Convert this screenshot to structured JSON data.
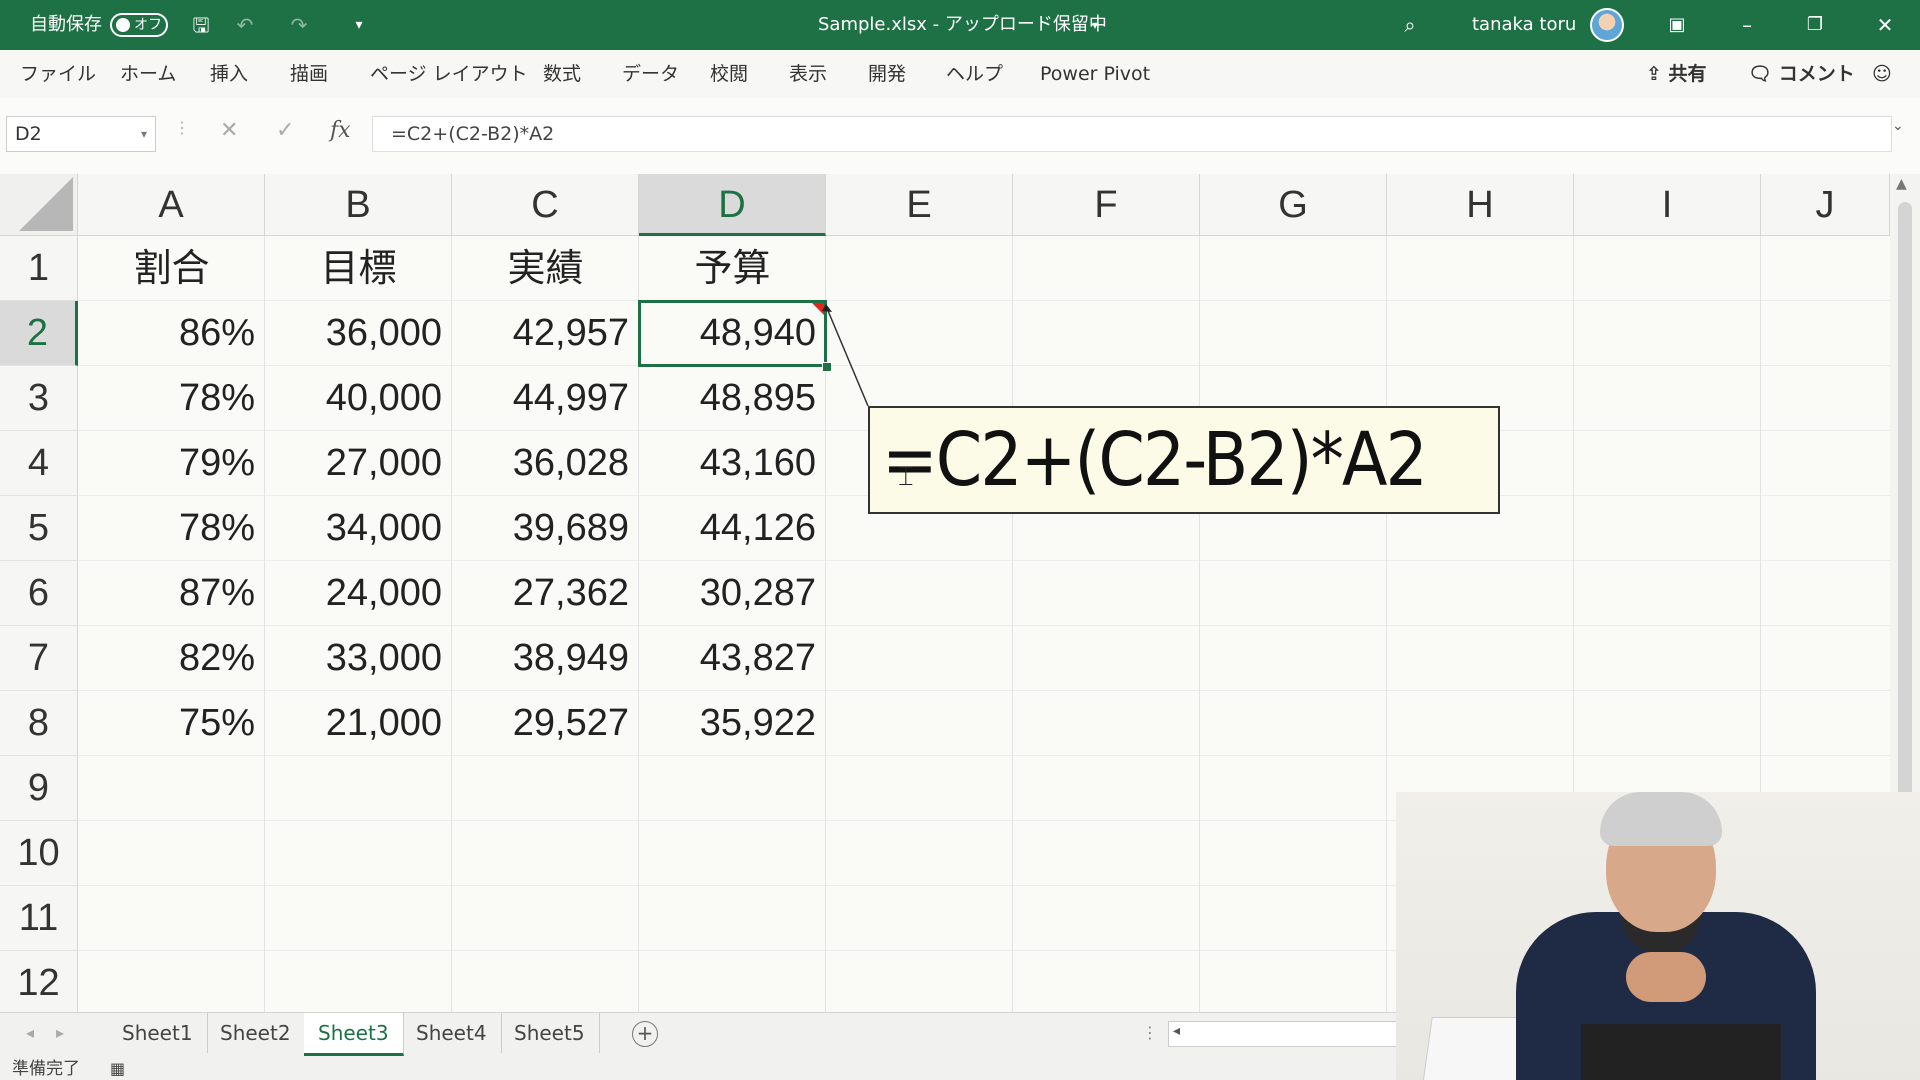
{
  "titlebar": {
    "autosave_label": "自動保存",
    "autosave_state": "オフ",
    "document_title": "Sample.xlsx - アップロード保留中",
    "user_name": "tanaka toru",
    "accent_color": "#1e7145"
  },
  "ribbon": {
    "tabs": [
      "ファイル",
      "ホーム",
      "挿入",
      "描画",
      "ページ レイアウト",
      "数式",
      "データ",
      "校閲",
      "表示",
      "開発",
      "ヘルプ",
      "Power Pivot"
    ],
    "share_label": "共有",
    "comment_label": "コメント"
  },
  "formula_bar": {
    "name_box": "D2",
    "fx_label": "fx",
    "formula": "=C2+(C2-B2)*A2"
  },
  "grid": {
    "columns": [
      "A",
      "B",
      "C",
      "D",
      "E",
      "F",
      "G",
      "H",
      "I",
      "J"
    ],
    "rows": [
      "1",
      "2",
      "3",
      "4",
      "5",
      "6",
      "7",
      "8",
      "9",
      "10",
      "11",
      "12"
    ],
    "selected_cell": "D2",
    "headers": [
      "割合",
      "目標",
      "実績",
      "予算"
    ],
    "data": [
      [
        "86%",
        "36,000",
        "42,957",
        "48,940"
      ],
      [
        "78%",
        "40,000",
        "44,997",
        "48,895"
      ],
      [
        "79%",
        "27,000",
        "36,028",
        "43,160"
      ],
      [
        "78%",
        "34,000",
        "39,689",
        "44,126"
      ],
      [
        "87%",
        "24,000",
        "27,362",
        "30,287"
      ],
      [
        "82%",
        "33,000",
        "38,949",
        "43,827"
      ],
      [
        "75%",
        "21,000",
        "29,527",
        "35,922"
      ]
    ]
  },
  "callout": {
    "text": "=C2+(C2-B2)*A2"
  },
  "sheet_tabs": {
    "tabs": [
      "Sheet1",
      "Sheet2",
      "Sheet3",
      "Sheet4",
      "Sheet5"
    ],
    "active": "Sheet3"
  },
  "status_bar": {
    "text": "準備完了"
  }
}
